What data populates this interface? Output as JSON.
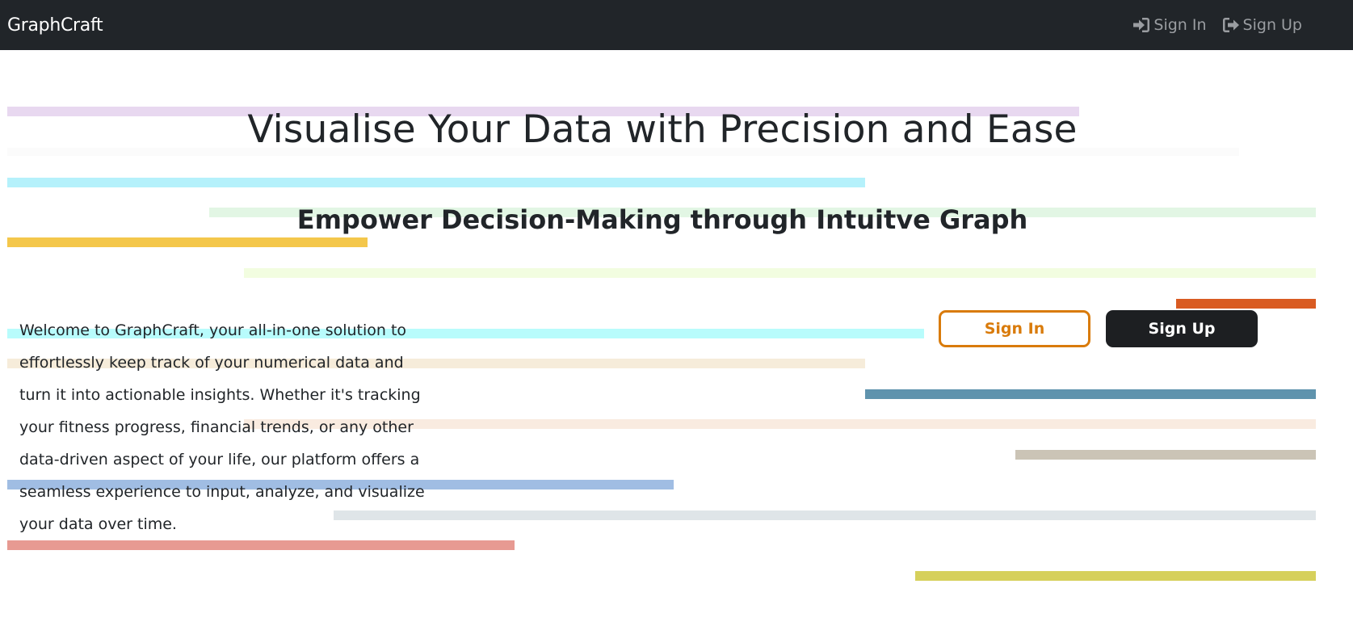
{
  "navbar": {
    "brand": "GraphCraft",
    "links": [
      {
        "label": "Sign In",
        "icon": "sign-in-icon"
      },
      {
        "label": "Sign Up",
        "icon": "sign-up-icon"
      }
    ]
  },
  "hero": {
    "title": "Visualise Your Data with Precision and Ease",
    "subtitle": "Empower Decision-Making through Intuitve Graph",
    "intro": "Welcome to GraphCraft, your all-in-one solution to effortlessly keep track of your numerical data and turn it into actionable insights. Whether it's tracking your fitness progress, financial trends, or any other data-driven aspect of your life, our platform offers a seamless experience to input, analyze, and visualize your data over time."
  },
  "actions": {
    "sign_in": "Sign In",
    "sign_up": "Sign Up"
  },
  "colors": {
    "navbar_bg": "#212529",
    "sign_in_accent": "#d97b0b",
    "sign_up_bg": "#1d1f22"
  }
}
